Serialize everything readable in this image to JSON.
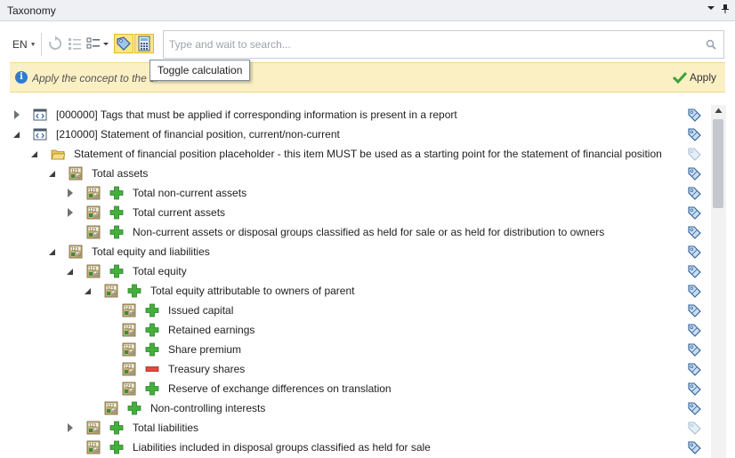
{
  "window": {
    "title": "Taxonomy",
    "dropdown_icon": "chevron-down-icon",
    "pin_icon": "pin-icon"
  },
  "toolbar": {
    "language": "EN",
    "search_placeholder": "Type and wait to search...",
    "tooltip": "Toggle calculation"
  },
  "infobar": {
    "message": "Apply the concept to the selected fact",
    "apply_label": "Apply"
  },
  "tree": {
    "rows": [
      {
        "label": "[000000] Tags that must be applied if corresponding information is present in a report"
      },
      {
        "label": "[210000] Statement of financial position, current/non-current"
      },
      {
        "label": "Statement of financial position placeholder - this item MUST be used as a starting point for the statement of financial position"
      },
      {
        "label": "Total assets"
      },
      {
        "label": "Total non-current assets"
      },
      {
        "label": "Total current assets"
      },
      {
        "label": "Non-current assets or disposal groups classified as held for sale or as held for distribution to owners"
      },
      {
        "label": "Total equity and liabilities"
      },
      {
        "label": "Total equity"
      },
      {
        "label": "Total equity attributable to owners of parent"
      },
      {
        "label": "Issued capital"
      },
      {
        "label": "Retained earnings"
      },
      {
        "label": "Share premium"
      },
      {
        "label": "Treasury shares"
      },
      {
        "label": "Reserve of exchange differences on translation"
      },
      {
        "label": "Non-controlling interests"
      },
      {
        "label": "Total liabilities"
      },
      {
        "label": "Liabilities included in disposal groups classified as held for sale"
      }
    ]
  },
  "colors": {
    "accent_plus": "#3aa336",
    "minus": "#e0443a",
    "info": "#2f7bd1",
    "highlight": "#fde58a"
  }
}
